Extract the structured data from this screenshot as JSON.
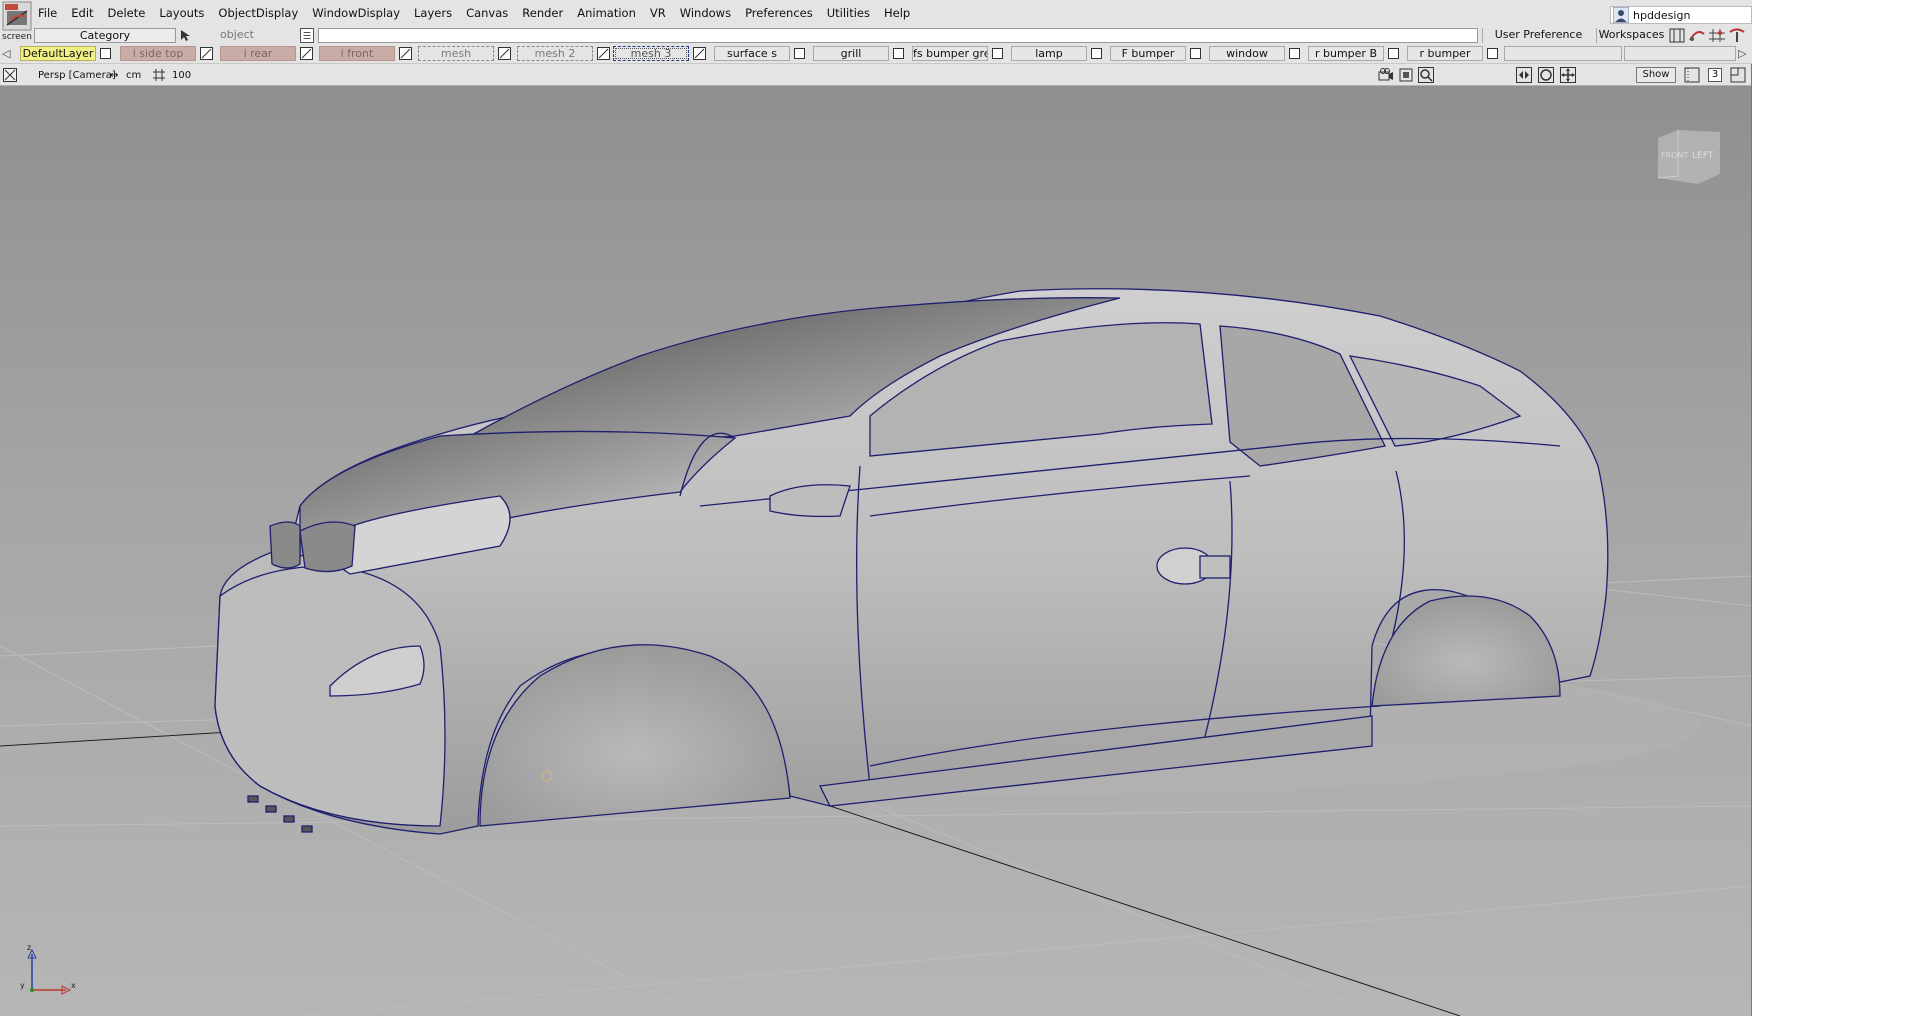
{
  "app": {
    "logo_caption": "screen",
    "user_name": "hpddesign"
  },
  "menu": [
    "File",
    "Edit",
    "Delete",
    "Layouts",
    "ObjectDisplay",
    "WindowDisplay",
    "Layers",
    "Canvas",
    "Render",
    "Animation",
    "VR",
    "Windows",
    "Preferences",
    "Utilities",
    "Help"
  ],
  "category_bar": {
    "category_label": "Category",
    "object_label": "object",
    "user_preference_sets": "User Preference Sets",
    "workspaces": "Workspaces"
  },
  "layers": [
    {
      "name": "DefaultLayer",
      "state": "default"
    },
    {
      "name": "i side top",
      "state": "locked"
    },
    {
      "name": "i rear",
      "state": "locked"
    },
    {
      "name": "i front",
      "state": "locked"
    },
    {
      "name": "mesh",
      "state": "invisible"
    },
    {
      "name": "mesh 2",
      "state": "invisible"
    },
    {
      "name": "mesh 3",
      "state": "selected"
    },
    {
      "name": "surface s",
      "state": "normal"
    },
    {
      "name": "grill",
      "state": "normal"
    },
    {
      "name": "fs bumper grey",
      "state": "normal"
    },
    {
      "name": "lamp",
      "state": "normal"
    },
    {
      "name": "F bumper",
      "state": "normal"
    },
    {
      "name": "window",
      "state": "normal"
    },
    {
      "name": "r bumper B",
      "state": "normal"
    },
    {
      "name": "r bumper",
      "state": "normal"
    },
    {
      "name": "",
      "state": "normal"
    },
    {
      "name": "",
      "state": "normal"
    }
  ],
  "viewport": {
    "camera": "Persp [Camera]",
    "units": "cm",
    "grid": "100",
    "show_label": "Show",
    "layout_count": "3",
    "view_cube_labels": [
      "FRONT",
      "LEFT"
    ],
    "axis_labels": {
      "x": "x",
      "y": "y",
      "z": "z"
    }
  },
  "colors": {
    "ui_bg": "#e4e4e4",
    "viewport_bg": "#a3a3a3",
    "default_layer": "#f2ef84",
    "locked_layer": "#c9aca5",
    "curve_color": "#1e1f6e"
  }
}
